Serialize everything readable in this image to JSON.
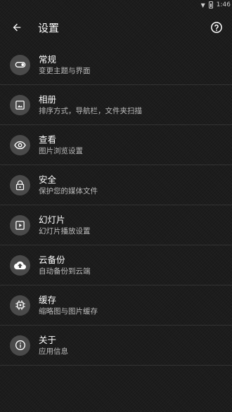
{
  "status_bar": {
    "time": "1:46"
  },
  "header": {
    "title": "设置"
  },
  "settings": [
    {
      "label": "常规",
      "desc": "变更主题与界面",
      "icon": "toggle-icon"
    },
    {
      "label": "相册",
      "desc": "排序方式，导航栏，文件夹扫描",
      "icon": "image-icon"
    },
    {
      "label": "查看",
      "desc": "图片浏览设置",
      "icon": "eye-icon"
    },
    {
      "label": "安全",
      "desc": "保护您的媒体文件",
      "icon": "lock-icon"
    },
    {
      "label": "幻灯片",
      "desc": "幻灯片播放设置",
      "icon": "slideshow-icon"
    },
    {
      "label": "云备份",
      "desc": "自动备份到云端",
      "icon": "cloud-upload-icon"
    },
    {
      "label": "缓存",
      "desc": "缩略图与图片缓存",
      "icon": "chip-icon"
    },
    {
      "label": "关于",
      "desc": "应用信息",
      "icon": "info-icon"
    }
  ],
  "colors": {
    "background": "#1c1c1c",
    "icon_circle": "#4a4a4a",
    "desc_text": "#bdbdbd"
  }
}
